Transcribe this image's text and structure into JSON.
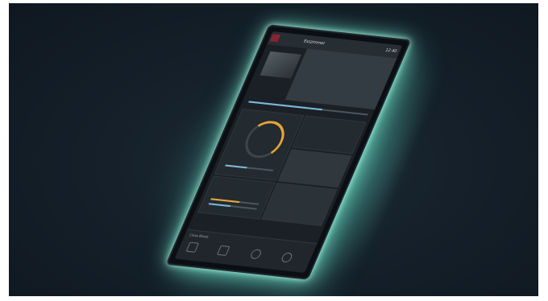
{
  "photo": {
    "subject": "wall-mounted smart home touch panel with glowing backlight",
    "colors": {
      "wall": "#15202a",
      "glow": "#8ff0d6",
      "accent": "#e9a43a",
      "blue": "#7cb8d6",
      "alert": "#8a2230"
    }
  },
  "screen": {
    "title": "Esszimmer",
    "clock": "12:40",
    "tiles": [
      "climate-ring",
      "media-controls",
      "camera-feed",
      "light-sliders",
      "scenes"
    ],
    "bottom_label": "Close Blinds",
    "nav_icons": [
      "home-icon",
      "building-icon",
      "bulb-icon",
      "gear-icon"
    ]
  }
}
